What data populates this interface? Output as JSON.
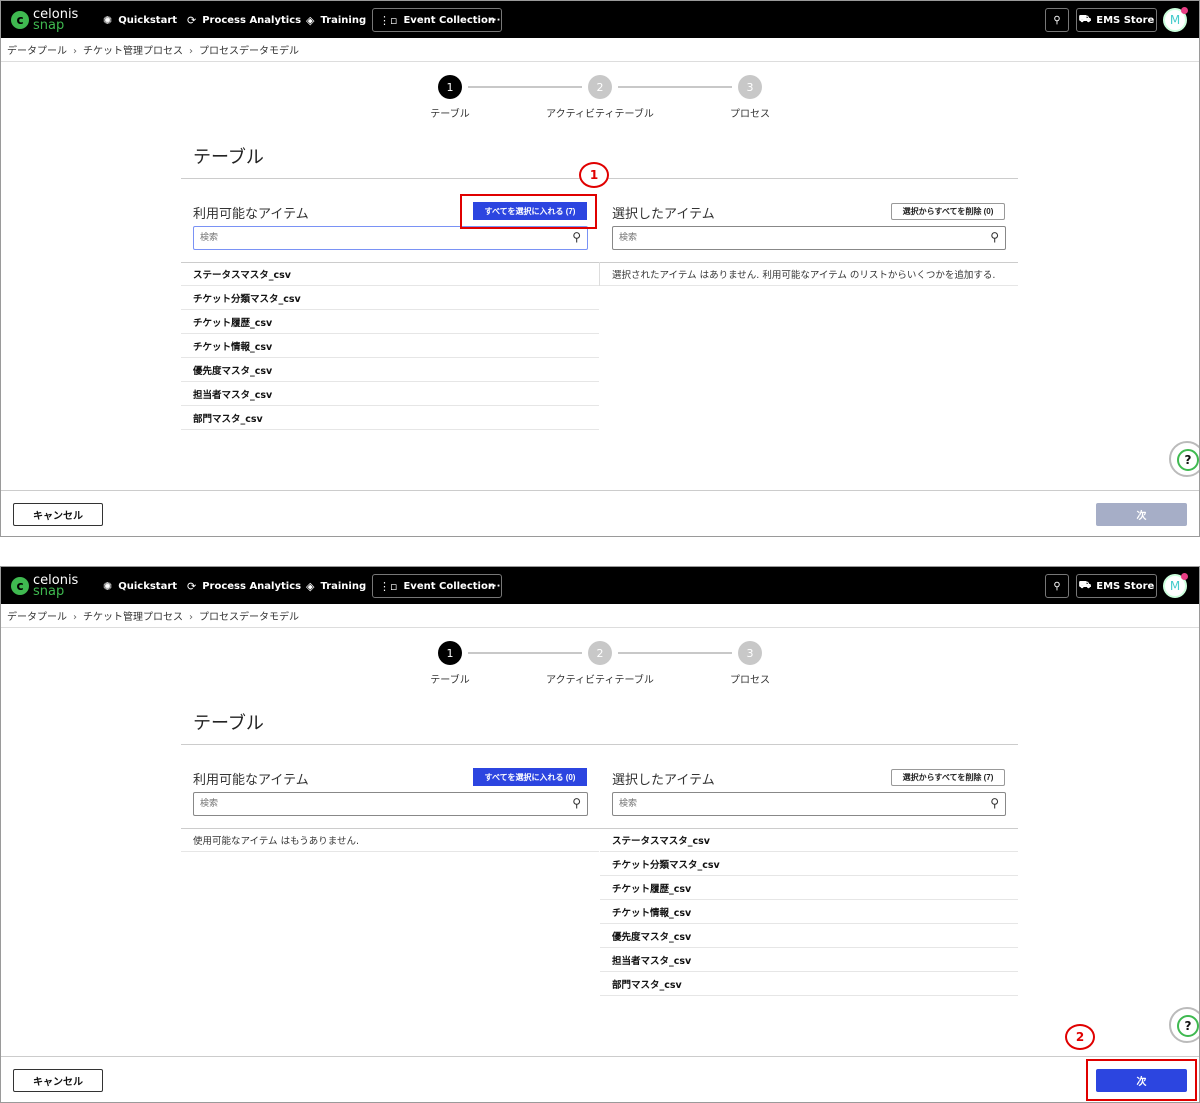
{
  "colors": {
    "nav_bg": "#000000",
    "brand_green": "#3fb950",
    "primary_blue": "#2c45e0",
    "disabled_blue": "#a6aec7",
    "annotation_red": "#e00000"
  },
  "nav": {
    "logo_line1": "celonis",
    "logo_line2": "snap",
    "logo_icon": "celonis-c-logo",
    "items": [
      {
        "label": "Quickstart",
        "icon": "quickstart-icon"
      },
      {
        "label": "Process Analytics",
        "icon": "process-analytics-icon"
      },
      {
        "label": "Training",
        "icon": "training-icon"
      },
      {
        "label": "Event Collection",
        "icon": "event-collection-icon"
      }
    ],
    "more": "···",
    "search_icon": "search-icon",
    "store_label": "EMS Store",
    "store_icon": "store-icon",
    "avatar_initial": "M"
  },
  "breadcrumb": [
    "データプール",
    "チケット管理プロセス",
    "プロセスデータモデル"
  ],
  "breadcrumb_separator": "›",
  "steps": [
    {
      "number": "1",
      "label": "テーブル"
    },
    {
      "number": "2",
      "label": "アクティビティテーブル"
    },
    {
      "number": "3",
      "label": "プロセス"
    }
  ],
  "section_title": "テーブル",
  "available_title": "利用可能なアイテム",
  "selected_title": "選択したアイテム",
  "search_placeholder": "検索",
  "cancel_label": "キャンセル",
  "next_label": "次",
  "panel1": {
    "select_all_label": "すべてを選択に入れる (7)",
    "remove_all_label": "選択からすべてを削除 (0)",
    "available_items": [
      "ステータスマスタ_csv",
      "チケット分類マスタ_csv",
      "チケット履歴_csv",
      "チケット情報_csv",
      "優先度マスタ_csv",
      "担当者マスタ_csv",
      "部門マスタ_csv"
    ],
    "selected_empty_message": "選択されたアイテム はありません. 利用可能なアイテム のリストからいくつかを追加する.",
    "callout": "1"
  },
  "panel2": {
    "select_all_label": "すべてを選択に入れる (0)",
    "remove_all_label": "選択からすべてを削除 (7)",
    "available_empty_message": "使用可能なアイテム はもうありません.",
    "selected_items": [
      "ステータスマスタ_csv",
      "チケット分類マスタ_csv",
      "チケット履歴_csv",
      "チケット情報_csv",
      "優先度マスタ_csv",
      "担当者マスタ_csv",
      "部門マスタ_csv"
    ],
    "callout": "2"
  }
}
